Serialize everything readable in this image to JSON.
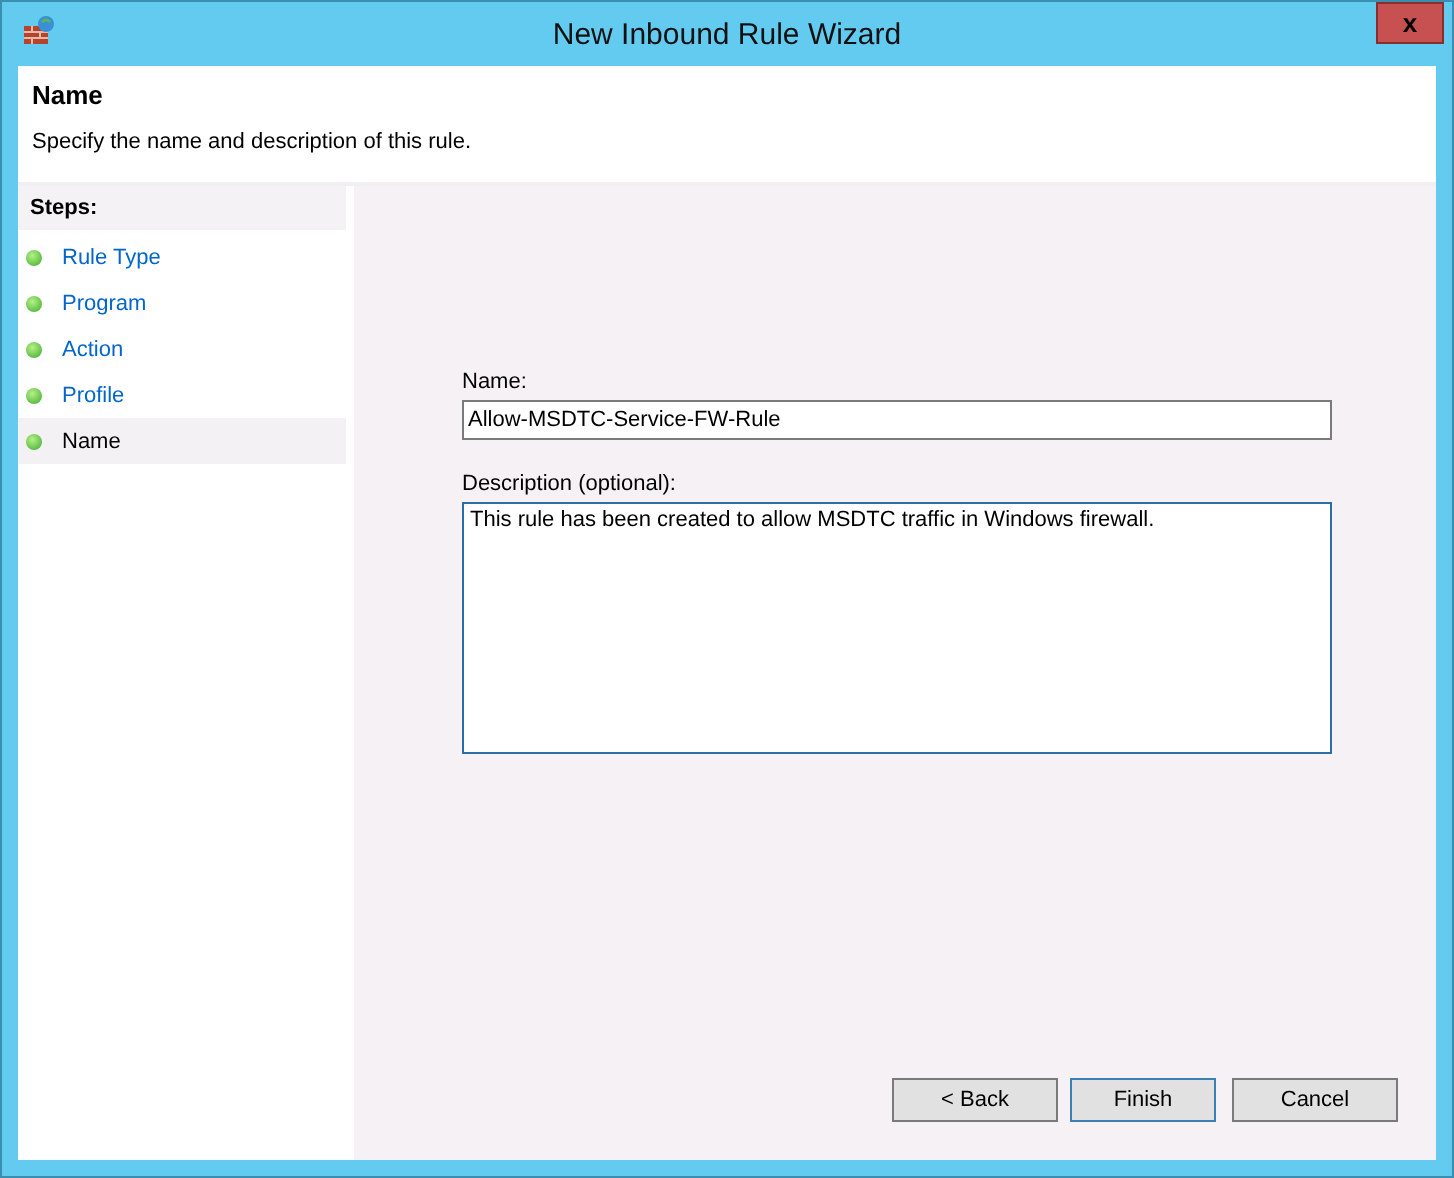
{
  "window": {
    "title": "New Inbound Rule Wizard",
    "close": "x"
  },
  "header": {
    "title": "Name",
    "subtitle": "Specify the name and description of this rule."
  },
  "steps": {
    "heading": "Steps:",
    "items": [
      {
        "label": "Rule Type",
        "selected": false
      },
      {
        "label": "Program",
        "selected": false
      },
      {
        "label": "Action",
        "selected": false
      },
      {
        "label": "Profile",
        "selected": false
      },
      {
        "label": "Name",
        "selected": true
      }
    ]
  },
  "form": {
    "name_label": "Name:",
    "name_value": "Allow-MSDTC-Service-FW-Rule",
    "description_label": "Description (optional):",
    "description_value": "This rule has been created to allow MSDTC traffic in Windows firewall."
  },
  "buttons": [
    {
      "label": "< Back",
      "default": false
    },
    {
      "label": "Finish",
      "default": true
    },
    {
      "label": "Cancel",
      "default": false
    }
  ]
}
